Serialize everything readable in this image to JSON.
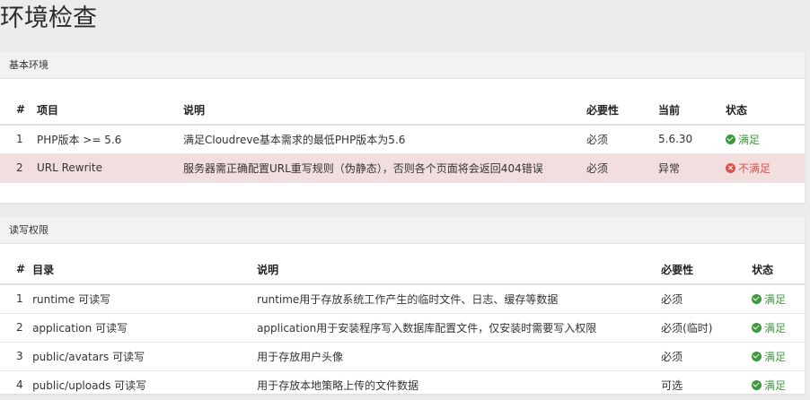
{
  "page": {
    "title": "环境检查"
  },
  "env_section": {
    "title": "基本环境",
    "headers": [
      "#",
      "项目",
      "说明",
      "必要性",
      "当前",
      "状态"
    ],
    "rows": [
      {
        "num": "1",
        "item": "PHP版本 >= 5.6",
        "desc": "满足Cloudreve基本需求的最低PHP版本为5.6",
        "required": "必须",
        "current": "5.6.30",
        "status": "满足",
        "ok": true
      },
      {
        "num": "2",
        "item": "URL Rewrite",
        "desc": "服务器需正确配置URL重写规则（伪静态），否则各个页面将会返回404错误",
        "required": "必须",
        "current": "异常",
        "status": "不满足",
        "ok": false
      }
    ]
  },
  "perm_section": {
    "title": "读写权限",
    "headers": [
      "#",
      "目录",
      "说明",
      "必要性",
      "状态"
    ],
    "rows": [
      {
        "num": "1",
        "dir": "runtime 可读写",
        "desc": "runtime用于存放系统工作产生的临时文件、日志、缓存等数据",
        "required": "必须",
        "status": "满足"
      },
      {
        "num": "2",
        "dir": "application 可读写",
        "desc": "application用于安装程序写入数据库配置文件，仅安装时需要写入权限",
        "required": "必须(临时)",
        "status": "满足"
      },
      {
        "num": "3",
        "dir": "public/avatars 可读写",
        "desc": "用于存放用户头像",
        "required": "必须",
        "status": "满足"
      },
      {
        "num": "4",
        "dir": "public/uploads 可读写",
        "desc": "用于存放本地策略上传的文件数据",
        "required": "可选",
        "status": "满足"
      }
    ]
  },
  "colors": {
    "ok": "#3c9a3c",
    "bad": "#d9534f",
    "danger_row": "#f2dede"
  },
  "icons": {
    "ok": "check-circle-icon",
    "bad": "times-circle-icon"
  }
}
